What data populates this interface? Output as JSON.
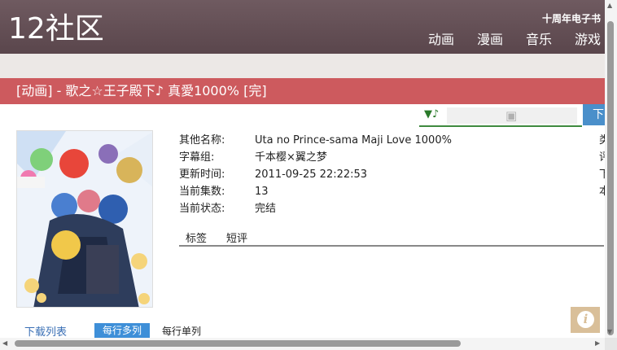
{
  "site": {
    "logo": "12社区",
    "top_link": "十周年电子书"
  },
  "nav": [
    "动画",
    "漫画",
    "音乐",
    "游戏"
  ],
  "page_title": "[动画] - 歌之☆王子殿下♪ 真愛1000% [完]",
  "music_strip": {
    "icon": "▼♪",
    "plugin_icon": "puzzle-piece-icon"
  },
  "download_button": "下",
  "info_rows": [
    {
      "label": "其他名称:",
      "value": "Uta no Prince-sama Maji Love 1000%"
    },
    {
      "label": "字幕组:",
      "value": "千本樱×翼之梦"
    },
    {
      "label": "更新时间:",
      "value": "2011-09-25 22:22:53"
    },
    {
      "label": "当前集数:",
      "value": "13"
    },
    {
      "label": "当前状态:",
      "value": "完结"
    }
  ],
  "right_column": [
    "类",
    "评",
    "下",
    "本"
  ],
  "tabs": [
    "标签",
    "短评"
  ],
  "download_list": {
    "title": "下载列表",
    "multi": "每行多列",
    "single": "每行单列"
  },
  "info_icon": "i",
  "colors": {
    "header": "#5f4a50",
    "title_bar": "#cd5a5e",
    "download_button": "#4a8fca",
    "multi_button": "#3e8fd8",
    "info_button": "#d9bf99"
  }
}
